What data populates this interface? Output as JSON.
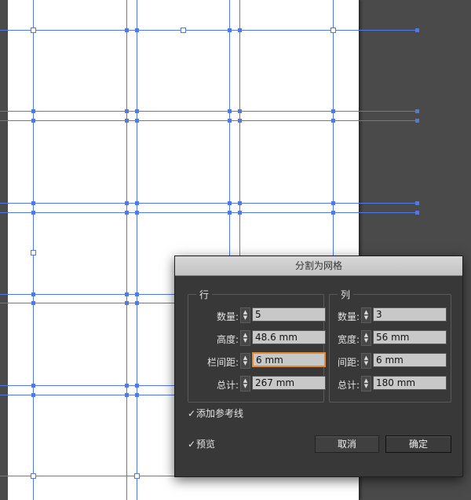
{
  "dialog": {
    "title": "分割为网格",
    "rows": {
      "title": "行",
      "fields": [
        {
          "label": "数量:",
          "value": "5"
        },
        {
          "label": "高度:",
          "value": "48.6 mm"
        },
        {
          "label": "栏间距:",
          "value": "6 mm"
        },
        {
          "label": "总计:",
          "value": "267 mm"
        }
      ]
    },
    "cols": {
      "title": "列",
      "fields": [
        {
          "label": "数量:",
          "value": "3"
        },
        {
          "label": "宽度:",
          "value": "56 mm"
        },
        {
          "label": "间距:",
          "value": "6 mm"
        },
        {
          "label": "总计:",
          "value": "180 mm"
        }
      ]
    },
    "add_guides": {
      "label": "添加参考线",
      "checked": true
    },
    "preview": {
      "label": "预览",
      "checked": true
    },
    "cancel_label": "取消",
    "ok_label": "确定"
  },
  "colors": {
    "guide": "#4f78e8",
    "focus": "#e38b2c"
  }
}
